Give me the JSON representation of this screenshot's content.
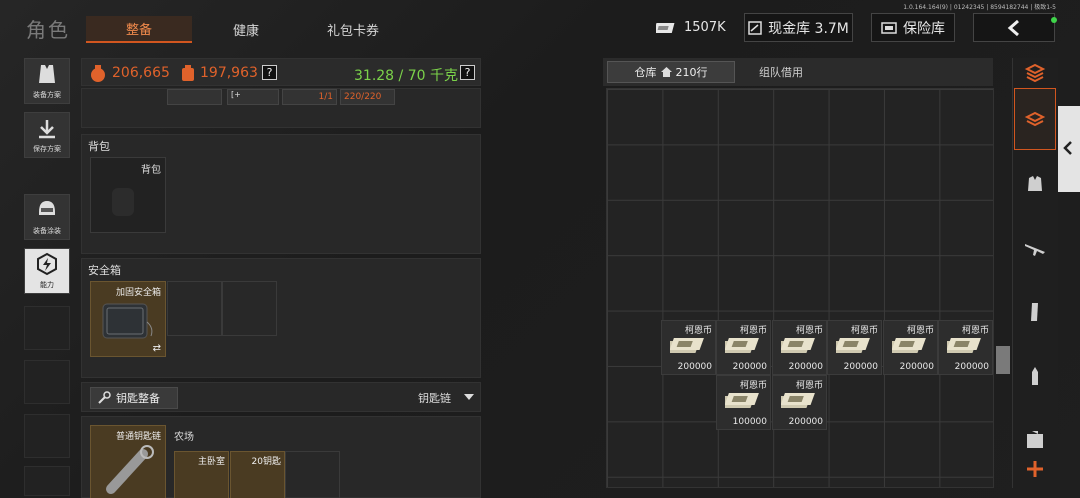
{
  "version": "1.0.164.164(9) | 01242345 | 8594182744 | 极致1-5",
  "title": "角色",
  "tabs": [
    "整备",
    "健康",
    "礼包卡券"
  ],
  "top": {
    "money": "1507K",
    "cash_vault": "现金库 3.7M",
    "safe": "保险库"
  },
  "sidebar": [
    {
      "label": "装备方案",
      "icon": "vest-icon"
    },
    {
      "label": "保存方案",
      "icon": "download-icon"
    },
    {
      "label": "装备涂装",
      "icon": "helmet-icon"
    },
    {
      "label": "能力",
      "icon": "ability-icon"
    }
  ],
  "stats": {
    "value1": "206,665",
    "value2": "197,963",
    "weight": "31.28 / 70 千克",
    "help": "?"
  },
  "equip_strip": {
    "count": "1/1",
    "ammo": "220/220"
  },
  "backpack": {
    "header": "背包",
    "slot_label": "背包"
  },
  "safebox": {
    "header": "安全箱",
    "item": "加固安全箱",
    "swap": "⇄"
  },
  "keys": {
    "button": "钥匙整备",
    "chain": "钥匙链",
    "chain_item": "普通钥匙链",
    "location": "农场",
    "key1": "主卧室",
    "key2": "20钥匙"
  },
  "right_tabs": {
    "warehouse": "仓库",
    "rows": "210行",
    "team": "组队借用"
  },
  "items": [
    {
      "name": "柯恩币",
      "count": "200000"
    },
    {
      "name": "柯恩币",
      "count": "200000"
    },
    {
      "name": "柯恩币",
      "count": "200000"
    },
    {
      "name": "柯恩币",
      "count": "200000"
    },
    {
      "name": "柯恩币",
      "count": "200000"
    },
    {
      "name": "柯恩币",
      "count": "200000"
    },
    {
      "name": "柯恩币",
      "count": "100000"
    },
    {
      "name": "柯恩币",
      "count": "200000"
    }
  ],
  "colors": {
    "accent": "#d2561f",
    "green": "#7bd24a",
    "orange": "#e0622b"
  },
  "filters": [
    "all-stack-icon",
    "box-icon",
    "armor-icon",
    "rifle-icon",
    "magazine-icon",
    "ammo-icon",
    "medkit-icon",
    "plus-icon"
  ]
}
